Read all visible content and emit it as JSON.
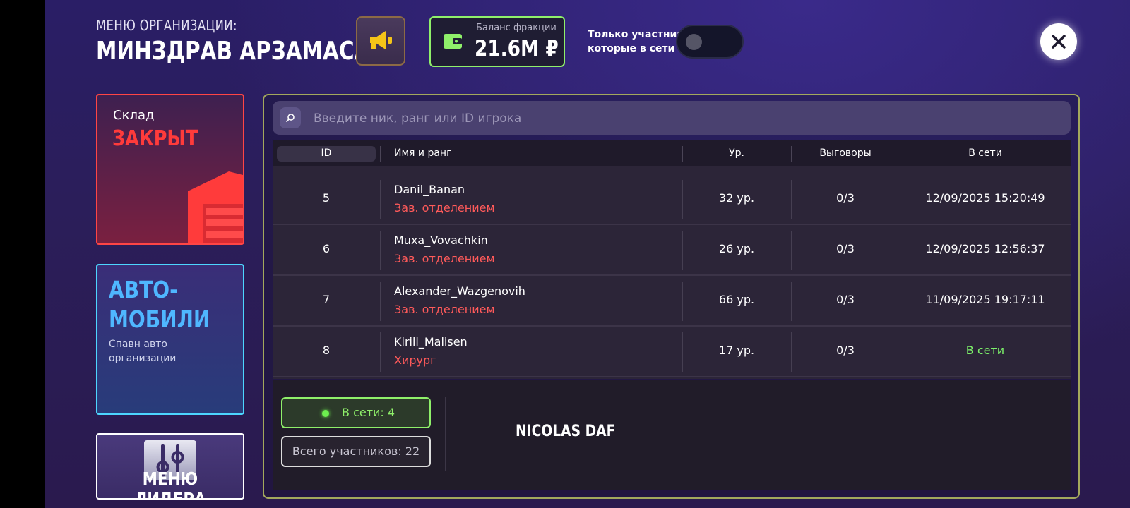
{
  "header": {
    "menu_title": "МЕНЮ ОРГАНИЗАЦИИ:",
    "org_name": "МИНЗДРАВ АРЗАМАСА",
    "balance_label": "Баланс фракции",
    "balance_value": "21.6M ₽",
    "toggle_label_line1": "Только участники,",
    "toggle_label_line2": "которые в сети",
    "toggle_on": false
  },
  "sidebar": {
    "store": {
      "title": "Склад",
      "state": "ЗАКРЫТ"
    },
    "auto": {
      "title_line1": "АВТО-",
      "title_line2": "МОБИЛИ",
      "desc_line1": "Спавн авто",
      "desc_line2": "организации"
    },
    "leader": {
      "label": "МЕНЮ ЛИДЕРА"
    }
  },
  "search": {
    "placeholder": "Введите ник, ранг или ID игрока"
  },
  "table": {
    "columns": {
      "id": "ID",
      "name": "Имя и ранг",
      "level": "Ур.",
      "warnings": "Выговоры",
      "online": "В сети"
    },
    "rows": [
      {
        "id": "5",
        "name": "Danil_Banan",
        "rank": "Зав. отделением",
        "level": "32 ур.",
        "warnings": "0/3",
        "online": "12/09/2025 15:20:49"
      },
      {
        "id": "6",
        "name": "Muxa_Vovachkin",
        "rank": "Зав. отделением",
        "level": "26 ур.",
        "warnings": "0/3",
        "online": "12/09/2025 12:56:37"
      },
      {
        "id": "7",
        "name": "Alexander_Wazgenovih",
        "rank": "Зав. отделением",
        "level": "66 ур.",
        "warnings": "0/3",
        "online": "11/09/2025 19:17:11"
      },
      {
        "id": "8",
        "name": "Kirill_Malisen",
        "rank": "Хирург",
        "level": "17 ур.",
        "warnings": "0/3",
        "online": "В сети"
      }
    ]
  },
  "footer": {
    "online_count": "В сети: 4",
    "total_members": "Всего участников: 22",
    "leader_name": "NICOLAS DAF"
  },
  "colors": {
    "accent_green": "#8ff06a",
    "danger_red": "#ff3b3b",
    "auto_blue": "#4fb7ff"
  }
}
